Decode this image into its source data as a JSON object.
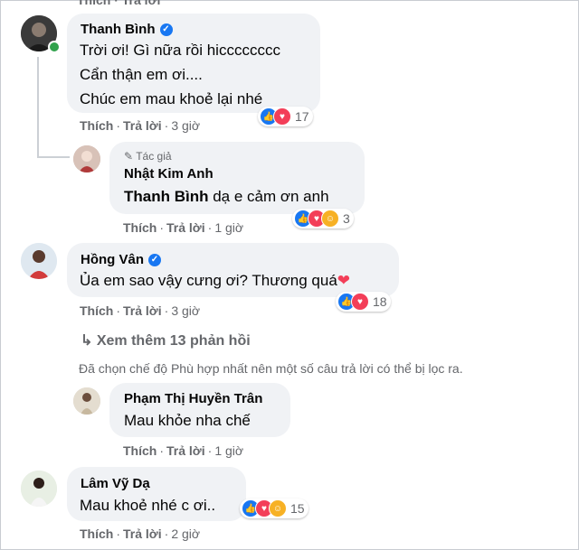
{
  "comments": [
    {
      "author": "Thanh Bình",
      "lines": [
        "Trời ơi! Gì nữa rồi hicccccccc",
        "Cẩn thận em ơi....",
        "Chúc em mau khoẻ lại nhé"
      ],
      "like_label": "Thích",
      "reply_label": "Trả lời",
      "time": "3 giờ",
      "reaction_count": "17"
    },
    {
      "author_tag": "Tác giả",
      "author": "Nhật Kim Anh",
      "mention": "Thanh Bình",
      "text": " dạ e cảm ơn anh",
      "like_label": "Thích",
      "reply_label": "Trả lời",
      "time": "1 giờ",
      "reaction_count": "3"
    },
    {
      "author": "Hồng Vân",
      "text": "Ủa em sao vậy cưng ơi? Thương quá",
      "like_label": "Thích",
      "reply_label": "Trả lời",
      "time": "3 giờ",
      "reaction_count": "18"
    },
    {
      "author": "Phạm Thị Huyền Trân",
      "text": "Mau khỏe nha chế",
      "like_label": "Thích",
      "reply_label": "Trả lời",
      "time": "1 giờ"
    },
    {
      "author": "Lâm Vỹ Dạ",
      "text": "Mau khoẻ nhé c ơi..",
      "like_label": "Thích",
      "reply_label": "Trả lời",
      "time": "2 giờ",
      "reaction_count": "15"
    }
  ],
  "more_replies": "Xem thêm 13 phản hồi",
  "filter_notice": "Đã chọn chế độ Phù hợp nhất nên một số câu trả lời có thể bị lọc ra.",
  "top_partial": "Thích · Trả lời",
  "colors": {
    "like": "#1877f2",
    "love": "#f33e58",
    "care": "#f7b125",
    "bubble": "#f0f2f5",
    "meta": "#65676b"
  }
}
